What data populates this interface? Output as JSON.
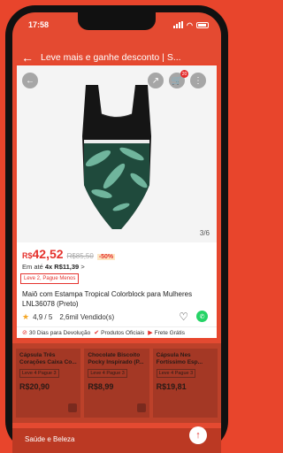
{
  "status": {
    "time": "17:58"
  },
  "nav": {
    "back_icon": "back-arrow-icon",
    "title": "Leve mais e ganhe desconto | S..."
  },
  "product": {
    "image_counter": "3/6",
    "price_currency": "R$",
    "price": "42,52",
    "old_price": "R$85,50",
    "discount": "-50%",
    "installment_prefix": "Em até",
    "installment_bold": "4x R$11,39",
    "installment_suffix": ">",
    "promo_tag": "Leve 2, Pague Menos",
    "title": "Maiô com Estampa Tropical Colorblock para Mulheres LNL36078 (Preto)",
    "rating": "4,9 / 5",
    "sold": "2,6mil Vendido(s)",
    "cart_count": "20"
  },
  "benefits": [
    {
      "label": "30 Dias para Devolução",
      "icon": "return-icon"
    },
    {
      "label": "Produtos Oficiais",
      "icon": "official-icon"
    },
    {
      "label": "Frete Grátis",
      "icon": "truck-icon"
    }
  ],
  "cards": [
    {
      "name": "Cápsula Três Corações Caixa Co...",
      "tag": "Leve 4 Pague 3",
      "price": "R$20,90"
    },
    {
      "name": "Chocolate Biscoito Pocky Inspirado (P...",
      "tag": "Leve 4 Pague 3",
      "price": "R$8,99"
    },
    {
      "name": "Cápsula Nes Fortíssimo Esp...",
      "tag": "Leve 4 Pague 3",
      "price": "R$19,81"
    }
  ],
  "bottom": {
    "label": "Saúde e Beleza"
  },
  "colors": {
    "accent": "#e5322d",
    "background": "#e8452c"
  }
}
